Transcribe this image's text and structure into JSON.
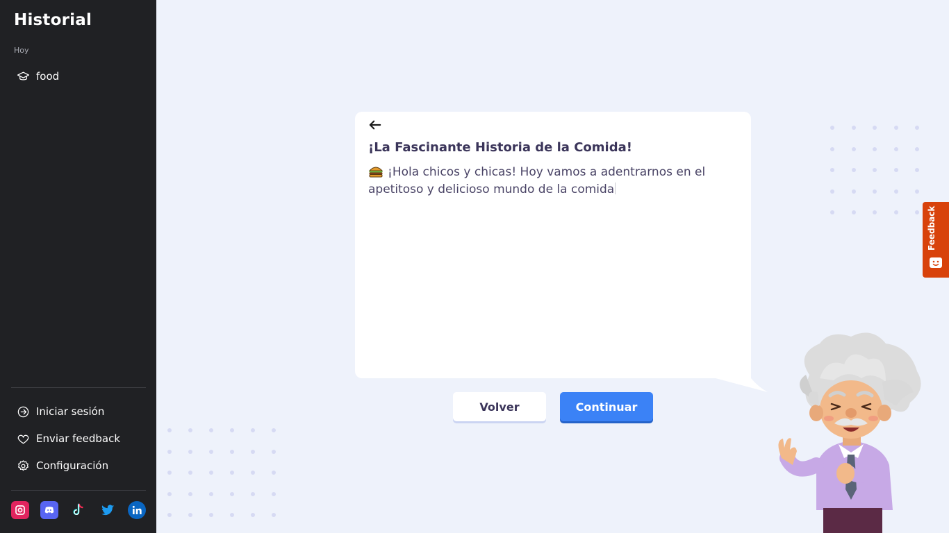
{
  "sidebar": {
    "title": "Historial",
    "section_label": "Hoy",
    "history_items": [
      {
        "label": "food",
        "icon": "graduation-cap-icon"
      }
    ],
    "menu": [
      {
        "label": "Iniciar sesión",
        "icon": "login-icon"
      },
      {
        "label": "Enviar feedback",
        "icon": "heart-icon"
      },
      {
        "label": "Configuración",
        "icon": "gear-icon"
      }
    ],
    "socials": [
      "instagram-icon",
      "discord-icon",
      "tiktok-icon",
      "twitter-icon",
      "linkedin-icon"
    ]
  },
  "story": {
    "title": "¡La Fascinante Historia de la Comida!",
    "text": "¡Hola chicos y chicas! Hoy vamos a adentrarnos en el apetitoso y delicioso mundo de la comida",
    "emoji_icon": "hamburger-icon"
  },
  "buttons": {
    "back_label": "Volver",
    "continue_label": "Continuar"
  },
  "feedback_tab": {
    "label": "Feedback"
  },
  "colors": {
    "sidebar_bg": "#202124",
    "page_bg": "#eef2fb",
    "primary": "#3b82f6",
    "feedback": "#d8420b"
  }
}
